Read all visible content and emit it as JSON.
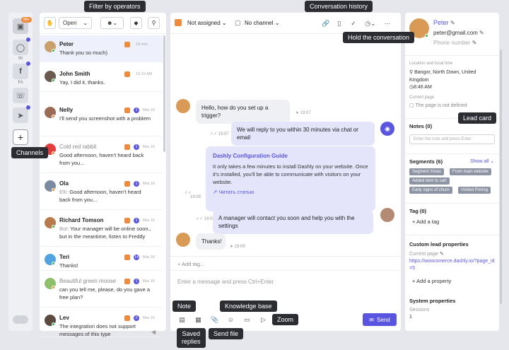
{
  "tooltips": {
    "filter_by_operators": "Filter by operators",
    "conversation_history": "Conversation history",
    "hold_the_conversation": "Hold the conversation",
    "channels": "Channels",
    "lead_card": "Lead card",
    "note": "Note",
    "saved_replies": "Saved\nreplies",
    "send_file": "Send file",
    "knowledge_base": "Knowledge base",
    "zoom": "Zoom"
  },
  "rail": {
    "badge": "99+",
    "instagram_label": "IN",
    "facebook_label": "FA"
  },
  "list_header": {
    "status_value": "Open"
  },
  "conversations": [
    {
      "name": "Peter",
      "preview": "Thank you so much)",
      "time": "18 min.",
      "grey": false,
      "who": ""
    },
    {
      "name": "John Smith",
      "preview": "Yay, I did it, thanks.",
      "time": "10:19 AM",
      "grey": false,
      "who": ""
    },
    {
      "name": "Nelly",
      "preview": "I'll send you screenshot with a problem",
      "time": "Mar 16",
      "grey": false,
      "who": "",
      "badge": "1"
    },
    {
      "name": "Cold red rabbit",
      "preview": "Good afternoon, haven't heard back from you...",
      "time": "Mar 16",
      "grey": true,
      "who": "",
      "badge": "1"
    },
    {
      "name": "Ola",
      "preview": "Good afternoon, haven't heard back from you...",
      "time": "Mar 16",
      "grey": false,
      "who": "Elli:",
      "badge": "1"
    },
    {
      "name": "Richard Tomson",
      "preview": "Your manager will be online soon., but in the meantime, listen to Freddy",
      "time": "Mar 16",
      "grey": false,
      "who": "Bot:",
      "badge": "1"
    },
    {
      "name": "Teri",
      "preview": "Thanks!",
      "time": "Mar 16",
      "grey": false,
      "who": "",
      "badge": "14"
    },
    {
      "name": "Beautiful green moose",
      "preview": "can you tell me, please, do you gave a free plan?",
      "time": "Mar 16",
      "grey": true,
      "who": "",
      "badge": "1"
    },
    {
      "name": "Lev",
      "preview": "The integration does not support messages of this type",
      "time": "Mar 16",
      "grey": false,
      "who": "",
      "badge": "2"
    }
  ],
  "chat_header": {
    "assignee": "Not assigned",
    "channel": "No channel"
  },
  "messages": [
    {
      "text": "Hello, how do you set up a trigger?",
      "time": "19:07",
      "dir": "in"
    },
    {
      "text": "We will reply to you within 30 minutes via chat or email",
      "time": "19:07",
      "dir": "out"
    },
    {
      "text": "A manager will contact you soon and help you with the settings",
      "time": "19:08",
      "dir": "out"
    },
    {
      "text": "Thanks!",
      "time": "19:09",
      "dir": "in"
    }
  ],
  "article_card": {
    "title": "Dashly Configuration Guide",
    "body": "It only takes a few minutes to install Dashly on your website. Once it's installed, you'll be able to communicate with visitors on your website.",
    "link": "Читать статью",
    "time": "19:08"
  },
  "composer": {
    "add_tag": "+ Add tag...",
    "placeholder": "Enter a message and press Ctrl+Enter",
    "send_label": "Send"
  },
  "lead": {
    "name": "Peter",
    "email": "peter@gmail.com",
    "phone_placeholder": "Phone number",
    "location_label": "Location and local time",
    "location": "Bangor, North Down, United Kingdom",
    "local_time": "8:46 AM",
    "page_label": "Current page",
    "page_value": "The page is not defined",
    "notes_title": "Notes (0)",
    "notes_placeholder": "Enter the note and press Enter",
    "segments_title": "Segments (6)",
    "show_all": "Show all",
    "segments": [
      "Segment Xmas",
      "From main website",
      "Added item to cart",
      "Early signs of churn",
      "Visited Pricing"
    ],
    "tag_title": "Tag (0)",
    "add_tag": "+ Add a tag",
    "custom_title": "Custom lead properties",
    "custom_page_label": "Current page",
    "custom_page_value": "https://woocomerce.dashly.io/?page_id=5",
    "add_property": "+ Add a property",
    "system_title": "System properties",
    "sessions_label": "Sessions",
    "sessions_value": "1"
  },
  "colors": {
    "accent": "#5a55e0",
    "tooltip": "#2b2d33",
    "operator": "#f08a3c"
  }
}
